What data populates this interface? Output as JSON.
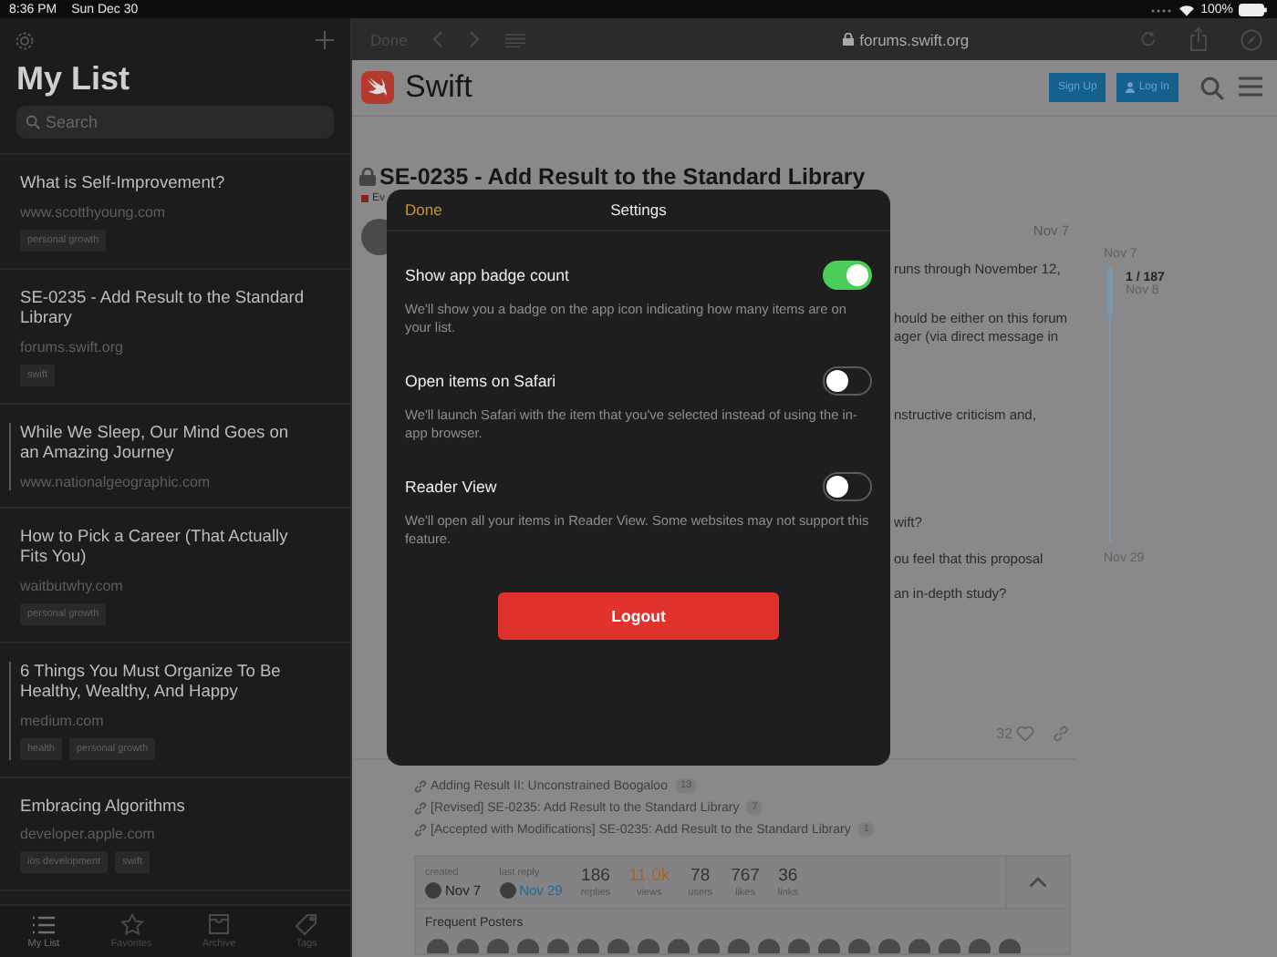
{
  "status_bar": {
    "time": "8:36 PM",
    "date": "Sun Dec 30",
    "battery": "100%"
  },
  "sidebar": {
    "title": "My List",
    "search": {
      "placeholder": "Search"
    },
    "items": [
      {
        "title": "What is Self-Improvement?",
        "site": "www.scotthyoung.com",
        "tags": [
          "personal growth"
        ],
        "flagged": false
      },
      {
        "title": "SE-0235 - Add Result to the Standard Library",
        "site": "forums.swift.org",
        "tags": [
          "swift"
        ],
        "flagged": false
      },
      {
        "title": "While We Sleep, Our Mind Goes on an Amazing Journey",
        "site": "www.nationalgeographic.com",
        "flagged": true
      },
      {
        "title": "How to Pick a Career (That Actually Fits You)",
        "site": "waitbutwhy.com",
        "tags": [
          "personal growth"
        ],
        "flagged": false
      },
      {
        "title": "6 Things You Must Organize To Be Healthy, Wealthy, And Happy",
        "site": "medium.com",
        "tags": [
          "health",
          "personal growth"
        ],
        "flagged": true
      },
      {
        "title": "Embracing Algorithms",
        "site": "developer.apple.com",
        "tags": [
          "ios development",
          "swift"
        ],
        "flagged": false
      }
    ],
    "tab_bar": [
      {
        "label": "My List",
        "kind": "list",
        "selected": true
      },
      {
        "label": "Favorites",
        "kind": "star",
        "selected": false
      },
      {
        "label": "Archive",
        "kind": "archive",
        "selected": false
      },
      {
        "label": "Tags",
        "kind": "tag",
        "selected": false
      }
    ]
  },
  "browser": {
    "done": "Done",
    "address": "forums.swift.org"
  },
  "page": {
    "brand": "Swift",
    "sign_up": "Sign Up",
    "log_in": "Log In",
    "topic_title": "SE-0235 - Add Result to the Standard Library",
    "category": "Ev",
    "post": {
      "date": "Nov 7",
      "paragraphs": [
        [
          "runs through November 12,"
        ],
        [
          "hould be either on this forum",
          "ager (via direct message in"
        ],
        [
          "nstructive criticism and,"
        ],
        [
          "wift?"
        ],
        [
          "ou feel that this proposal"
        ],
        [
          "an in-depth study?"
        ]
      ],
      "likes": "32"
    },
    "timeline": {
      "start": "Nov 7",
      "position": "1 / 187",
      "position_date": "Nov 8",
      "end": "Nov 29"
    },
    "links": [
      {
        "title": "Adding Result II: Unconstrained Boogaloo",
        "count": "13"
      },
      {
        "title": "[Revised] SE-0235: Add Result to the Standard Library",
        "count": "7"
      },
      {
        "title": "[Accepted with Modifications] SE-0235: Add Result to the Standard Library",
        "count": "1"
      }
    ],
    "stats": {
      "created_label": "created",
      "created": "Nov 7",
      "last_reply_label": "last reply",
      "last_reply": "Nov 29",
      "figures": [
        {
          "value": "186",
          "label": "replies",
          "hot": false
        },
        {
          "value": "11.0k",
          "label": "views",
          "hot": true
        },
        {
          "value": "78",
          "label": "users",
          "hot": false
        },
        {
          "value": "767",
          "label": "likes",
          "hot": false
        },
        {
          "value": "36",
          "label": "links",
          "hot": false
        }
      ]
    },
    "frequent_posters": "Frequent Posters"
  },
  "settings": {
    "done": "Done",
    "title": "Settings",
    "options": [
      {
        "label": "Show app badge count",
        "description": "We'll show you a badge on the app icon indicating how many items are on your list.",
        "on": true
      },
      {
        "label": "Open items on Safari",
        "description": "We'll launch Safari with the item that you've selected instead of using the in-app browser.",
        "on": false
      },
      {
        "label": "Reader View",
        "description": "We'll open all your items in Reader View. Some websites may not support this feature.",
        "on": false
      }
    ],
    "logout": "Logout"
  }
}
